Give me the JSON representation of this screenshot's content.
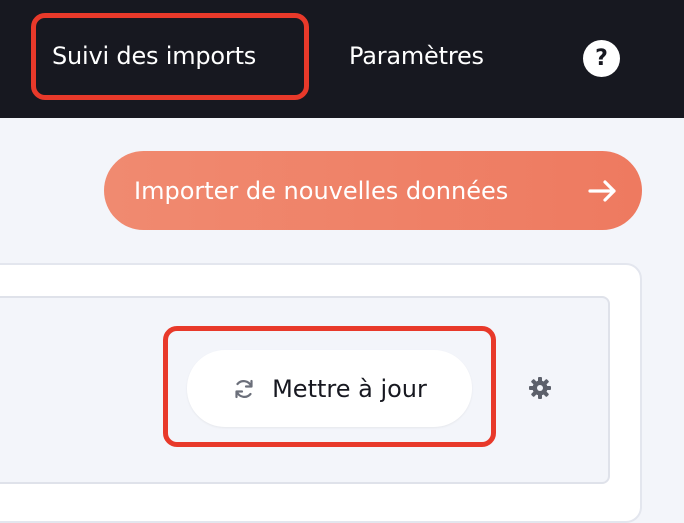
{
  "topbar": {
    "nav_items": [
      {
        "label": "Suivi des imports",
        "active": true
      },
      {
        "label": "Paramètres",
        "active": false
      }
    ],
    "help_label": "?",
    "help_icon": "question-circle-icon"
  },
  "main": {
    "import_button": {
      "label": "Importer de nouvelles données",
      "icon": "arrow-right-icon"
    },
    "refresh_button": {
      "label": "Mettre à jour",
      "icon": "refresh-icon"
    },
    "settings_icon": "gear-icon"
  },
  "colors": {
    "topbar_bg": "#171820",
    "accent_gradient_start": "#f08a70",
    "accent_gradient_end": "#ee7a60",
    "highlight": "#e8392a",
    "page_bg": "#f3f5fa"
  }
}
